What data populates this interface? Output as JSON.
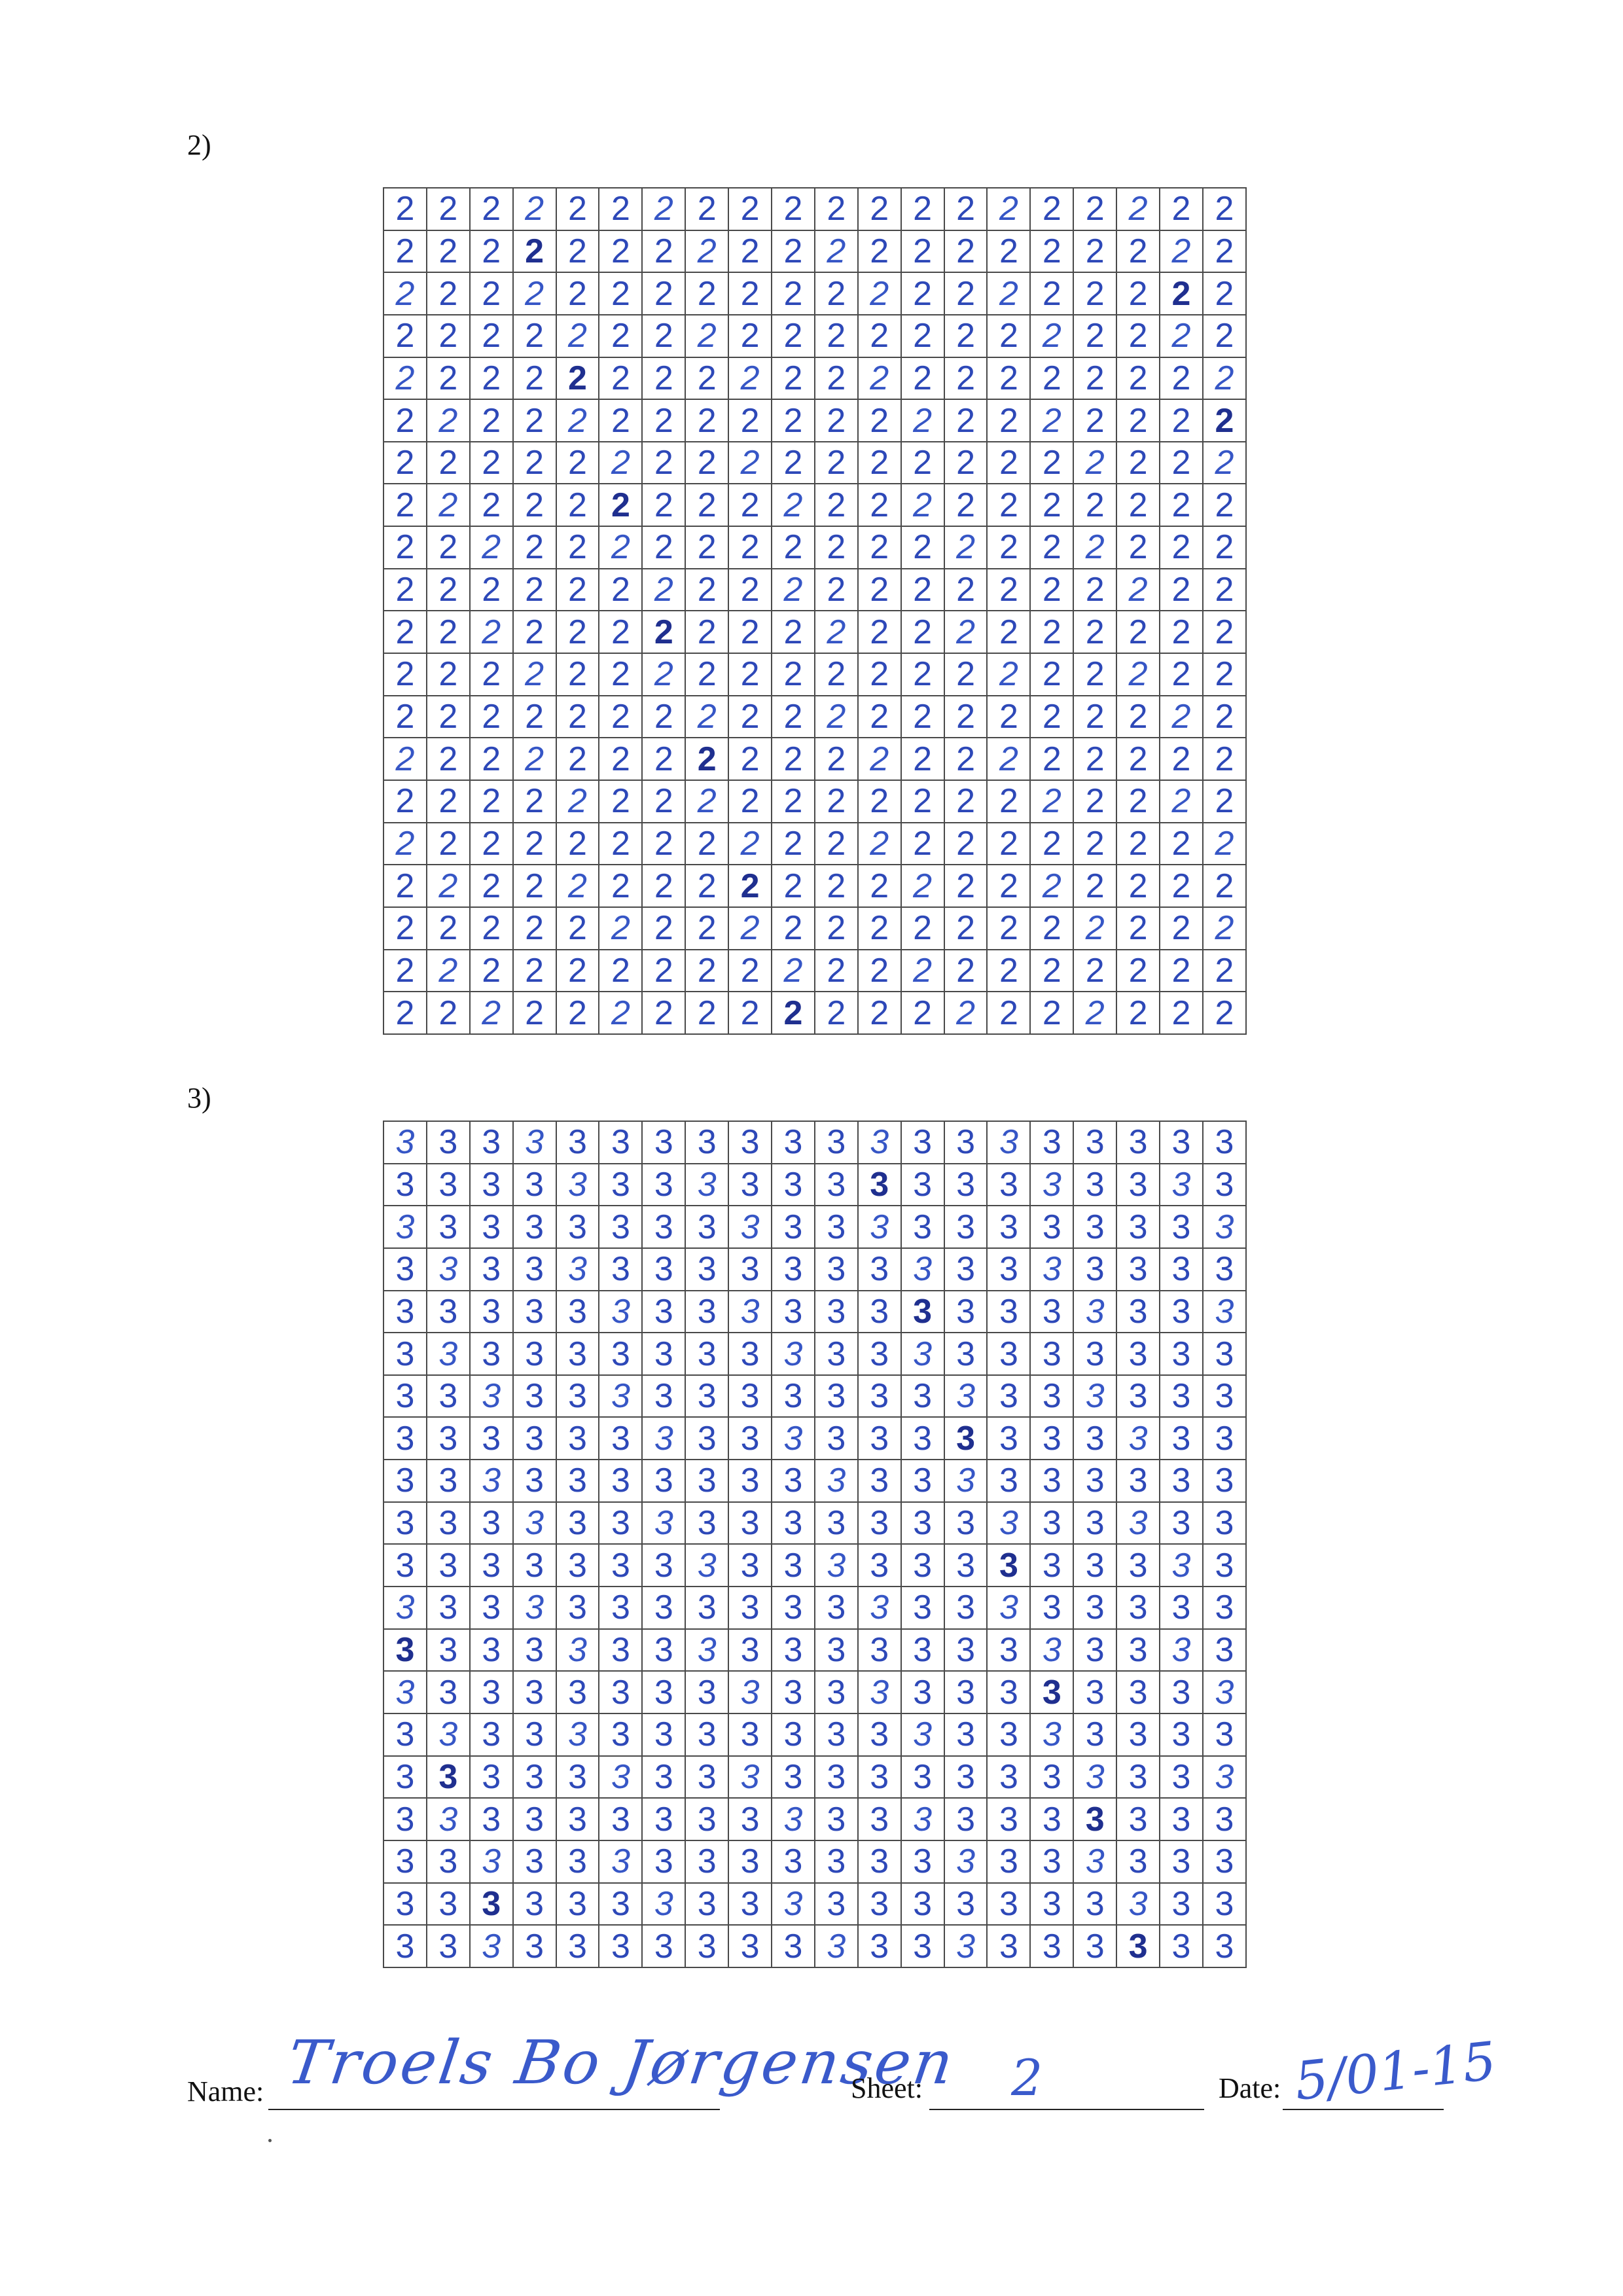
{
  "sections": [
    {
      "label": "2)",
      "digit": "2",
      "rows": 20,
      "cols": 20
    },
    {
      "label": "3)",
      "digit": "3",
      "rows": 20,
      "cols": 20
    }
  ],
  "footer": {
    "name_label": "Name:",
    "name_value": "Troels Bo Jørgensen",
    "sheet_label": "Sheet:",
    "sheet_value": "2",
    "date_label": "Date:",
    "date_value": "5/01-15"
  },
  "colors": {
    "ink": "#2d48b8",
    "grid_line": "#4a4a4a"
  }
}
